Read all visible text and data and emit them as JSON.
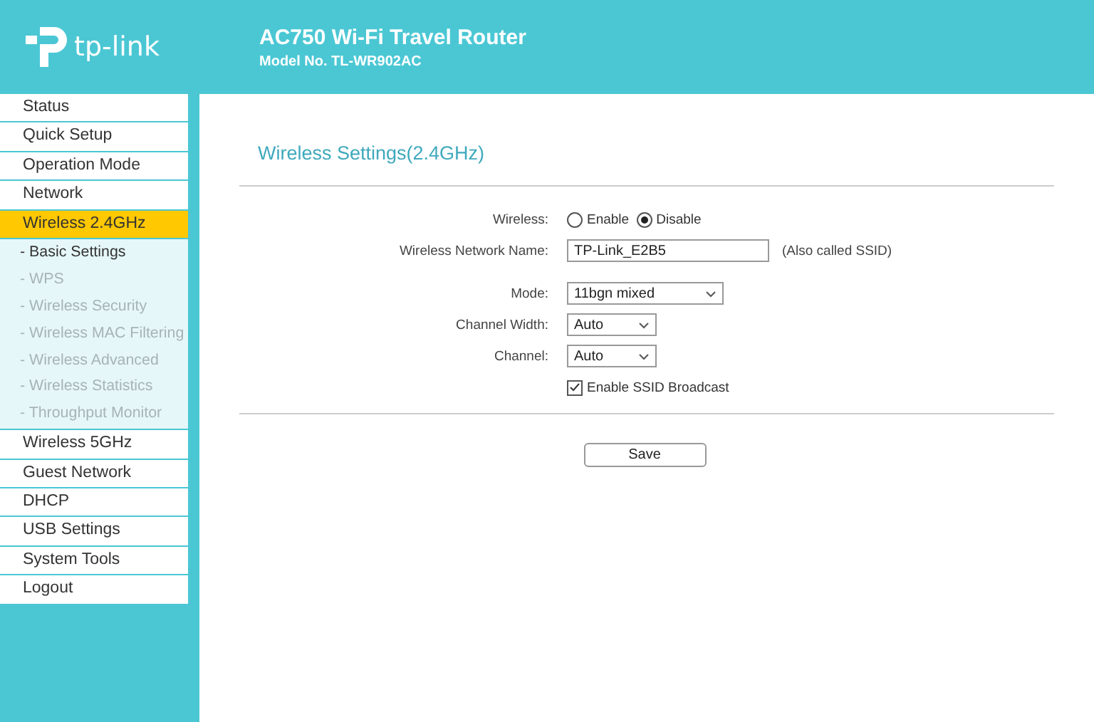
{
  "header": {
    "brand": "tp-link",
    "title": "AC750 Wi-Fi Travel Router",
    "model": "Model No. TL-WR902AC"
  },
  "sidebar": {
    "items": [
      {
        "label": "Status",
        "selected": false
      },
      {
        "label": "Quick Setup",
        "selected": false
      },
      {
        "label": "Operation Mode",
        "selected": false
      },
      {
        "label": "Network",
        "selected": false
      },
      {
        "label": "Wireless 2.4GHz",
        "selected": true,
        "children": [
          {
            "label": "- Basic Settings",
            "selected": true
          },
          {
            "label": "- WPS",
            "selected": false
          },
          {
            "label": "- Wireless Security",
            "selected": false
          },
          {
            "label": "- Wireless MAC Filtering",
            "selected": false
          },
          {
            "label": "- Wireless Advanced",
            "selected": false
          },
          {
            "label": "- Wireless Statistics",
            "selected": false
          },
          {
            "label": "- Throughput Monitor",
            "selected": false
          }
        ]
      },
      {
        "label": "Wireless 5GHz",
        "selected": false
      },
      {
        "label": "Guest Network",
        "selected": false
      },
      {
        "label": "DHCP",
        "selected": false
      },
      {
        "label": "USB Settings",
        "selected": false
      },
      {
        "label": "System Tools",
        "selected": false
      },
      {
        "label": "Logout",
        "selected": false
      }
    ]
  },
  "page": {
    "title": "Wireless Settings(2.4GHz)",
    "fields": [
      {
        "kind": "radio",
        "label": "Wireless:",
        "options": [
          {
            "label": "Enable",
            "selected": false
          },
          {
            "label": "Disable",
            "selected": true
          }
        ]
      },
      {
        "kind": "text",
        "label": "Wireless Network Name:",
        "value": "TP-Link_E2B5",
        "note": "(Also called SSID)"
      },
      {
        "kind": "select",
        "label": "Mode:",
        "value": "11bgn mixed",
        "wide": true
      },
      {
        "kind": "select",
        "label": "Channel Width:",
        "value": "Auto",
        "wide": false
      },
      {
        "kind": "select",
        "label": "Channel:",
        "value": "Auto",
        "wide": false
      },
      {
        "kind": "checkbox",
        "label": "Enable SSID Broadcast",
        "checked": true
      }
    ],
    "save_button": "Save"
  }
}
